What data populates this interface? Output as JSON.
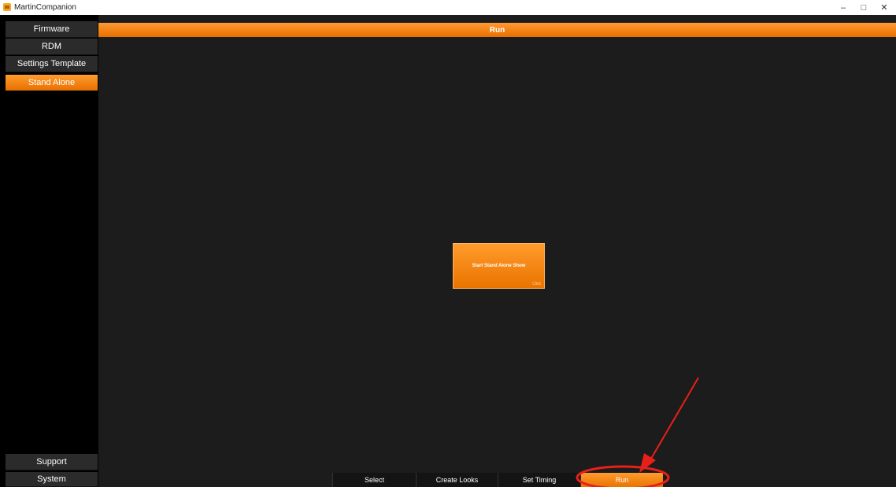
{
  "window": {
    "title": "MartinCompanion",
    "minimize_label": "–",
    "maximize_label": "□",
    "close_label": "✕"
  },
  "sidebar": {
    "items": [
      {
        "label": "Firmware"
      },
      {
        "label": "RDM"
      },
      {
        "label": "Settings Template"
      },
      {
        "label": "Stand Alone"
      }
    ],
    "bottom_items": [
      {
        "label": "Support"
      },
      {
        "label": "System"
      }
    ]
  },
  "main": {
    "header_title": "Run",
    "start_button_label": "Start Stand Alone Show",
    "start_button_hint": "Click"
  },
  "bottom_tabs": [
    {
      "label": "Select"
    },
    {
      "label": "Create Looks"
    },
    {
      "label": "Set Timing"
    },
    {
      "label": "Run"
    }
  ],
  "colors": {
    "accent": "#f08010",
    "sidebar_item": "#2b2b2b",
    "main_bg": "#1c1c1c",
    "annotation": "#e8201a"
  }
}
